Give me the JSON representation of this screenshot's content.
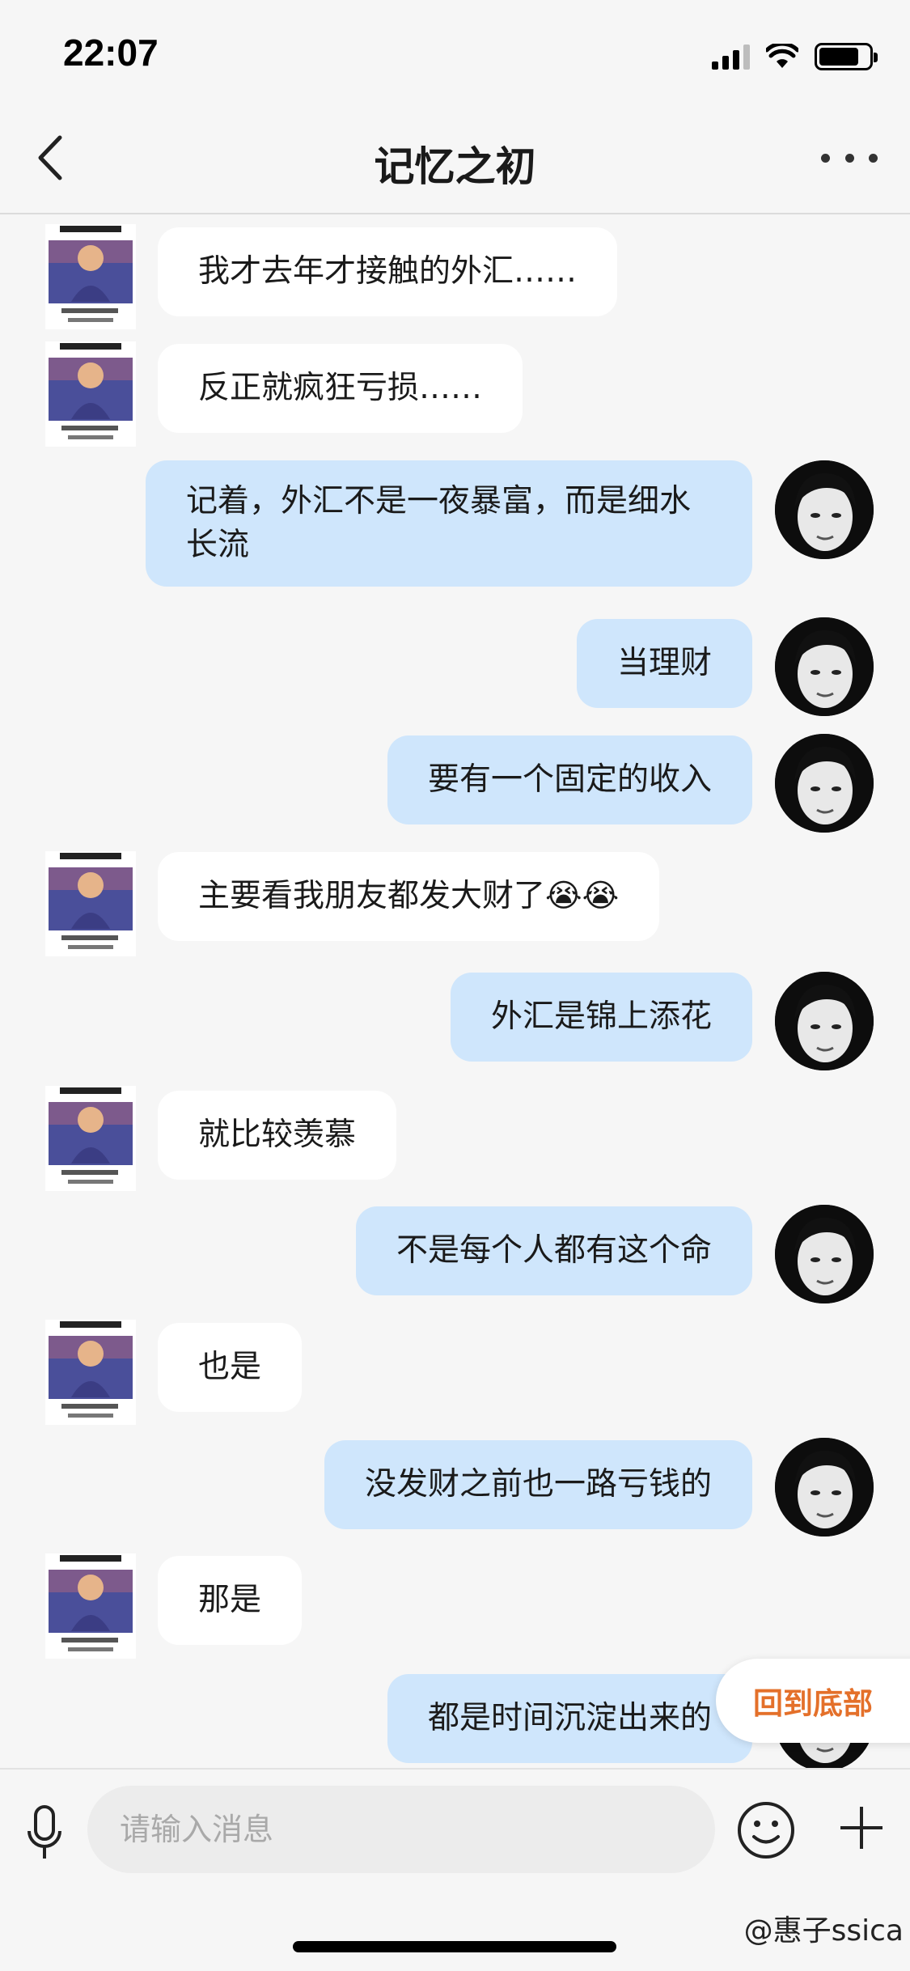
{
  "status_bar": {
    "time": "22:07",
    "battery_level": 0.8
  },
  "header": {
    "title": "记忆之初"
  },
  "messages": [
    {
      "side": "left",
      "text": "我才去年才接触的外汇……"
    },
    {
      "side": "left",
      "text": "反正就疯狂亏损……"
    },
    {
      "side": "right",
      "text": "记着，外汇不是一夜暴富，而是细水长流"
    },
    {
      "side": "right",
      "text": "当理财"
    },
    {
      "side": "right",
      "text": "要有一个固定的收入"
    },
    {
      "side": "left",
      "text": "主要看我朋友都发大财了😭😭"
    },
    {
      "side": "right",
      "text": "外汇是锦上添花"
    },
    {
      "side": "left",
      "text": "就比较羡慕"
    },
    {
      "side": "right",
      "text": "不是每个人都有这个命"
    },
    {
      "side": "left",
      "text": "也是"
    },
    {
      "side": "right",
      "text": "没发财之前也一路亏钱的"
    },
    {
      "side": "left",
      "text": "那是"
    },
    {
      "side": "right",
      "text": "都是时间沉淀出来的"
    }
  ],
  "back_to_bottom": "回到底部",
  "input": {
    "placeholder": "请输入消息"
  },
  "watermark": "@惠子ssica",
  "icons": {
    "back": "chevron-left-icon",
    "more": "more-dots-icon",
    "mic": "microphone-icon",
    "emoji": "emoji-icon",
    "plus": "plus-icon"
  },
  "colors": {
    "bubble_left": "#ffffff",
    "bubble_right": "#cfe6fc",
    "accent": "#e4702a"
  }
}
